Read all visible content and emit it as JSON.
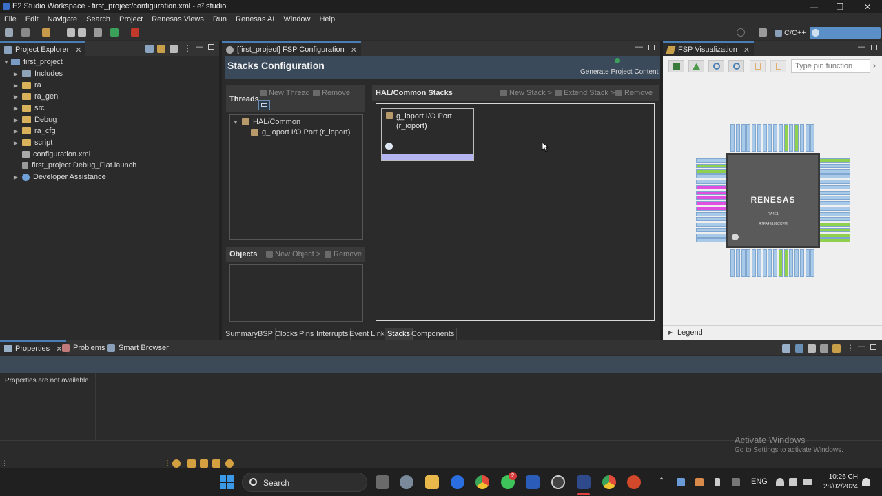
{
  "window": {
    "title": "E2 Studio Workspace - first_project/configuration.xml - e² studio"
  },
  "menu": [
    "File",
    "Edit",
    "Navigate",
    "Search",
    "Project",
    "Renesas Views",
    "Run",
    "Renesas AI",
    "Window",
    "Help"
  ],
  "toolbar": {
    "perspective_label": "C/C++"
  },
  "project_explorer": {
    "tab_label": "Project Explorer",
    "items": [
      {
        "label": "first_project",
        "icon": "project-icon"
      },
      {
        "label": "Includes",
        "icon": "includes-icon"
      },
      {
        "label": "ra",
        "icon": "folder-icon"
      },
      {
        "label": "ra_gen",
        "icon": "folder-icon"
      },
      {
        "label": "src",
        "icon": "folder-icon"
      },
      {
        "label": "Debug",
        "icon": "folder-icon"
      },
      {
        "label": "ra_cfg",
        "icon": "folder-icon"
      },
      {
        "label": "script",
        "icon": "folder-icon"
      },
      {
        "label": "configuration.xml",
        "icon": "gear-file-icon"
      },
      {
        "label": "first_project Debug_Flat.launch",
        "icon": "launch-file-icon"
      },
      {
        "label": "Developer Assistance",
        "icon": "help-icon"
      }
    ]
  },
  "editor": {
    "tab_label": "[first_project] FSP Configuration",
    "title": "Stacks Configuration",
    "generate_label": "Generate Project Content",
    "threads": {
      "header": "Threads",
      "new_label": "New Thread",
      "remove_label": "Remove",
      "tree_parent": "HAL/Common",
      "tree_child": "g_ioport I/O Port (r_ioport)"
    },
    "objects": {
      "header": "Objects",
      "new_label": "New Object >",
      "remove_label": "Remove"
    },
    "stacks": {
      "header": "HAL/Common Stacks",
      "new_label": "New Stack >",
      "extend_label": "Extend Stack >",
      "remove_label": "Remove",
      "module_line1": "g_ioport I/O Port",
      "module_line2": "(r_ioport)"
    },
    "bottom_tabs": [
      "Summary",
      "BSP",
      "Clocks",
      "Pins",
      "Interrupts",
      "Event Links",
      "Stacks",
      "Components"
    ],
    "active_bottom_tab": "Stacks"
  },
  "fsp_visualization": {
    "tab_label": "FSP Visualization",
    "search_placeholder": "Type pin function",
    "chip_brand": "RENESAS",
    "chip_line1": "RA4E1",
    "chip_line2": "R7FA4E10D2CFM",
    "legend_label": "Legend"
  },
  "bottom_panel": {
    "tabs": [
      "Properties",
      "Problems",
      "Smart Browser"
    ],
    "message": "Properties are not available."
  },
  "watermark": {
    "line1": "Activate Windows",
    "line2": "Go to Settings to activate Windows."
  },
  "taskbar": {
    "search_label": "Search",
    "lang": "ENG",
    "time": "10:26 CH",
    "date": "28/02/2024",
    "whatsapp_badge": "2"
  },
  "colors": {
    "accent": "#4a7fb5",
    "module_bar": "#b4b4f0",
    "pin_blue": "#a9c9e8",
    "pin_green": "#8fd14f",
    "pin_magenta": "#e050e0"
  }
}
